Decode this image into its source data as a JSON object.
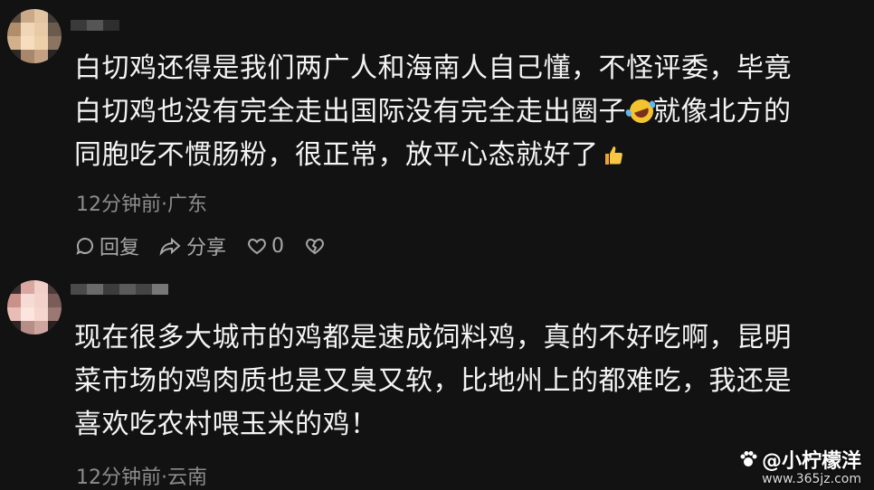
{
  "comments": [
    {
      "lines": [
        "白切鸡还得是我们两广人和海南人自己懂，不怪评委，毕竟",
        "白切鸡也没有完全走出国际没有完全走出圈子",
        "就像北方的",
        "同胞吃不惯肠粉，很正常，放平心态就好了"
      ],
      "emojis": [
        "laughing-tears-icon",
        "thumbs-up-icon"
      ],
      "meta": "12分钟前·广东",
      "actions": {
        "reply": "回复",
        "share": "分享",
        "likes": "0"
      }
    },
    {
      "lines": [
        "现在很多大城市的鸡都是速成饲料鸡，真的不好吃啊，昆明",
        "菜市场的鸡肉质也是又臭又软，比地州上的都难吃，我还是",
        "喜欢吃农村喂玉米的鸡！"
      ],
      "meta": "12分钟前·云南"
    }
  ],
  "watermark": {
    "name": "@小柠檬洋",
    "url": "www.365jz.com"
  },
  "colors": {
    "background": "#121212",
    "text": "#f4f4f4",
    "meta": "#8c8c8c",
    "action": "#a8a8a8"
  }
}
